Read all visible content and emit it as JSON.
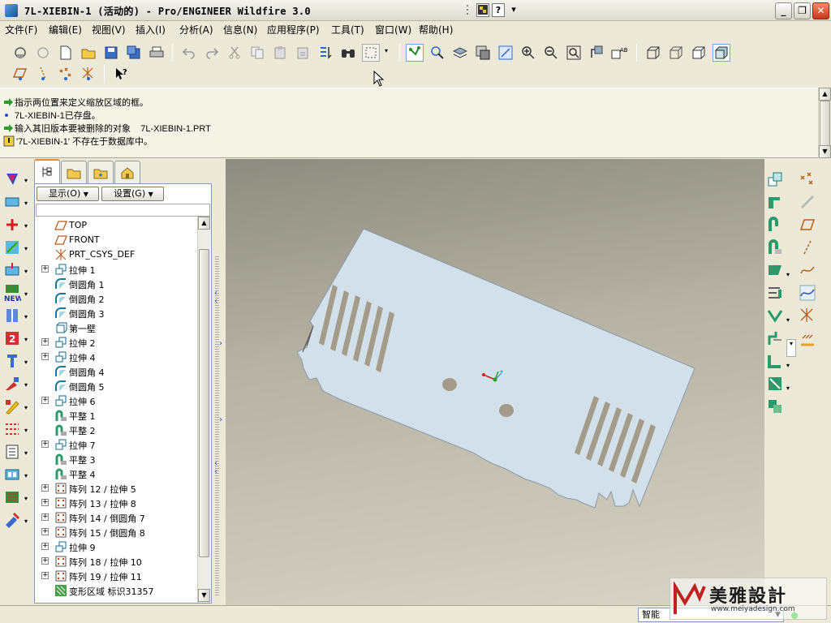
{
  "window": {
    "title": "7L-XIEBIN-1 (活动的) - Pro/ENGINEER Wildfire 3.0",
    "mini_help": "?"
  },
  "menu": [
    "文件(F)",
    "编辑(E)",
    "视图(V)",
    "插入(I)",
    "分析(A)",
    "信息(N)",
    "应用程序(P)",
    "工具(T)",
    "窗口(W)",
    "帮助(H)"
  ],
  "messages": [
    {
      "icon": "green-arrow-icon",
      "text": "指示两位置来定义缩放区域的框。"
    },
    {
      "icon": "blue-dot-icon",
      "text": "7L-XIEBIN-1已存盘。"
    },
    {
      "icon": "green-arrow-icon",
      "text": "输入其旧版本要被删除的对象    7L-XIEBIN-1.PRT"
    },
    {
      "icon": "warning-icon",
      "text": "'7L-XIEBIN-1' 不存在于数据库中。"
    }
  ],
  "model_tree": {
    "show_label": "显示(O)",
    "settings_label": "设置(G)",
    "items": [
      {
        "label": "TOP",
        "icon": "datum-plane-icon",
        "expandable": false
      },
      {
        "label": "FRONT",
        "icon": "datum-plane-icon",
        "expandable": false
      },
      {
        "label": "PRT_CSYS_DEF",
        "icon": "csys-icon",
        "expandable": false
      },
      {
        "label": "拉伸 1",
        "icon": "extrude-icon",
        "expandable": true
      },
      {
        "label": "倒圆角 1",
        "icon": "round-icon",
        "expandable": false
      },
      {
        "label": "倒圆角 2",
        "icon": "round-icon",
        "expandable": false
      },
      {
        "label": "倒圆角 3",
        "icon": "round-icon",
        "expandable": false
      },
      {
        "label": "第一壁",
        "icon": "wall-icon",
        "expandable": false
      },
      {
        "label": "拉伸 2",
        "icon": "extrude-icon",
        "expandable": true
      },
      {
        "label": "拉伸 4",
        "icon": "extrude-icon",
        "expandable": true
      },
      {
        "label": "倒圆角 4",
        "icon": "round-icon",
        "expandable": false
      },
      {
        "label": "倒圆角 5",
        "icon": "round-icon",
        "expandable": false
      },
      {
        "label": "拉伸 6",
        "icon": "extrude-icon",
        "expandable": true
      },
      {
        "label": "平整 1",
        "icon": "flat-icon",
        "expandable": false
      },
      {
        "label": "平整 2",
        "icon": "flat-icon",
        "expandable": false
      },
      {
        "label": "拉伸 7",
        "icon": "extrude-icon",
        "expandable": true
      },
      {
        "label": "平整 3",
        "icon": "flat-icon",
        "expandable": false
      },
      {
        "label": "平整 4",
        "icon": "flat-icon",
        "expandable": false
      },
      {
        "label": "阵列 12 / 拉伸 5",
        "icon": "pattern-icon",
        "expandable": true
      },
      {
        "label": "阵列 13 / 拉伸 8",
        "icon": "pattern-icon",
        "expandable": true
      },
      {
        "label": "阵列 14 / 倒圆角 7",
        "icon": "pattern-icon",
        "expandable": true
      },
      {
        "label": "阵列 15 / 倒圆角 8",
        "icon": "pattern-icon",
        "expandable": true
      },
      {
        "label": "拉伸 9",
        "icon": "extrude-icon",
        "expandable": true
      },
      {
        "label": "阵列 18 / 拉伸 10",
        "icon": "pattern-icon",
        "expandable": true
      },
      {
        "label": "阵列 19 / 拉伸 11",
        "icon": "pattern-icon",
        "expandable": true
      },
      {
        "label": "变形区域 标识31357",
        "icon": "deform-icon",
        "expandable": false
      }
    ]
  },
  "status": {
    "filter": "智能"
  },
  "watermark": {
    "brand": "美雅設計",
    "url": "www.meiyadesign.com"
  }
}
